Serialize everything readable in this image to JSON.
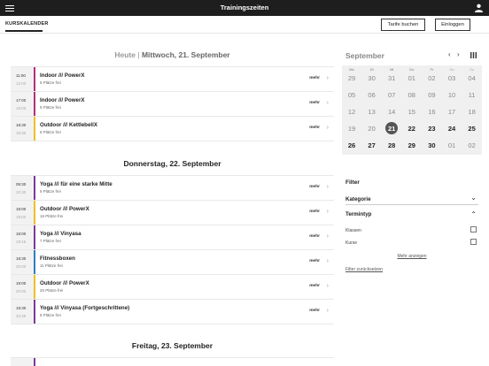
{
  "app": {
    "title": "Trainingszeiten"
  },
  "subnav": {
    "tab": "KURSKALENDER",
    "tarife_label": "Tarife buchen",
    "login_label": "Einloggen"
  },
  "days": [
    {
      "today_label": "Heute",
      "separator": "|",
      "label": "Mittwoch, 21. September",
      "courses": [
        {
          "start": "11:00",
          "end": "12:00",
          "name": "Indoor /// PowerX",
          "seats": "5 Plätze frei",
          "more": "mehr",
          "color": "#b32e7c"
        },
        {
          "start": "17:00",
          "end": "18:00",
          "name": "Indoor /// PowerX",
          "seats": "9 Plätze frei",
          "more": "mehr",
          "color": "#b32e7c"
        },
        {
          "start": "18:30",
          "end": "19:30",
          "name": "Outdoor /// KettlebellX",
          "seats": "8 Plätze frei",
          "more": "mehr",
          "color": "#f0c020"
        }
      ]
    },
    {
      "label": "Donnerstag, 22. September",
      "courses": [
        {
          "start": "09:30",
          "end": "10:30",
          "name": "Yoga /// für eine starke Mitte",
          "seats": "9 Plätze frei",
          "more": "mehr",
          "color": "#7b3a96"
        },
        {
          "start": "18:00",
          "end": "19:00",
          "name": "Outdoor /// PowerX",
          "seats": "16 Plätze frei",
          "more": "mehr",
          "color": "#f0c020"
        },
        {
          "start": "18:00",
          "end": "19:15",
          "name": "Yoga /// Vinyasa",
          "seats": "7 Plätze frei",
          "more": "mehr",
          "color": "#7b3a96"
        },
        {
          "start": "18:30",
          "end": "20:00",
          "name": "Fitnessboxen",
          "seats": "11 Plätze frei",
          "more": "mehr",
          "color": "#2d7fc1"
        },
        {
          "start": "19:00",
          "end": "20:00",
          "name": "Outdoor /// PowerX",
          "seats": "20 Plätze frei",
          "more": "mehr",
          "color": "#f0c020"
        },
        {
          "start": "19:30",
          "end": "20:45",
          "name": "Yoga /// Vinyasa (Fortgeschrittene)",
          "seats": "8 Plätze frei",
          "more": "mehr",
          "color": "#7b3a96"
        }
      ]
    },
    {
      "label": "Freitag, 23. September",
      "courses": []
    }
  ],
  "calendar": {
    "month": "September",
    "weekdays": [
      "Mo",
      "Di",
      "Mi",
      "Do",
      "Fr",
      "Sa",
      "So"
    ],
    "weeks": [
      [
        "29",
        "30",
        "31",
        "01",
        "02",
        "03",
        "04"
      ],
      [
        "05",
        "06",
        "07",
        "08",
        "09",
        "10",
        "11"
      ],
      [
        "12",
        "13",
        "14",
        "15",
        "16",
        "17",
        "18"
      ],
      [
        "19",
        "20",
        "21",
        "22",
        "23",
        "24",
        "25"
      ],
      [
        "26",
        "27",
        "28",
        "29",
        "30",
        "01",
        "02"
      ]
    ],
    "selected": "21"
  },
  "filter": {
    "title": "Filter",
    "category_label": "Kategorie",
    "type_label": "Termintyp",
    "options": [
      "Klassen",
      "Kurse"
    ],
    "show_more": "Mehr anzeigen",
    "reset": "Filter zurücksetzen"
  },
  "colors": {
    "topbar": "#1e1e1e",
    "selected_day": "#555555"
  }
}
